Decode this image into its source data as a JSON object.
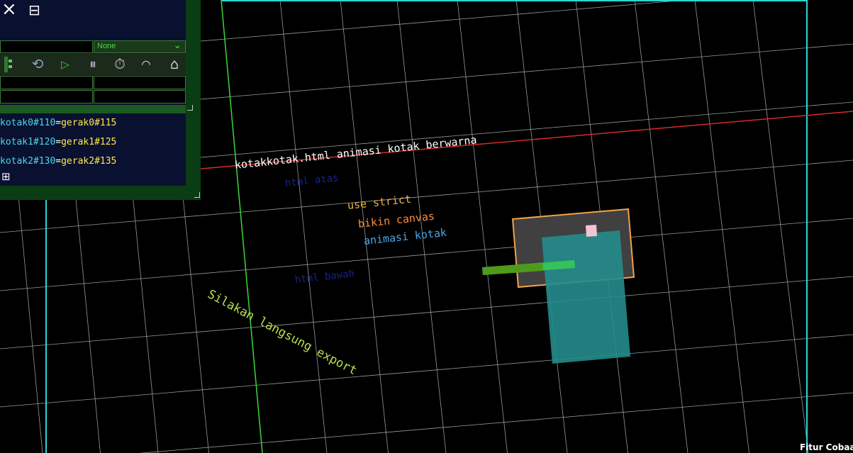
{
  "panel": {
    "close_icon": "×",
    "minimize_icon": "⊟",
    "select_value": "None",
    "add_icon": "⊞",
    "toolbar_icons": [
      "hierarchy-icon",
      "reset-icon",
      "play-icon",
      "pause-icon",
      "timer-icon",
      "speedometer-icon",
      "tag-icon"
    ],
    "mappings": [
      {
        "left": "kotak0#110",
        "eq": "=",
        "right": "gerak0#115"
      },
      {
        "left": "kotak1#120",
        "eq": "=",
        "right": "gerak1#125"
      },
      {
        "left": "kotak2#130",
        "eq": "=",
        "right": "gerak2#135"
      }
    ]
  },
  "canvas": {
    "title": "kotakkotak.html animasi kotak berwarna",
    "html_atas": "html atas",
    "use_strict": "use strict",
    "bikin_canvas": "bikin canvas",
    "animasi_kotak": "animasi kotak",
    "html_bawah": "html bawah",
    "silakan": "Silakan langsung export"
  },
  "footer": {
    "label": "Fitur Cobaan"
  },
  "colors": {
    "grid": "#a9b7b2",
    "cyan_border": "#2ad6d6",
    "green_line": "#39d839",
    "red_line": "#d62a2a",
    "white_text": "#ffffff",
    "dark_blue_text": "#15238c",
    "orange_text": "#f0b34a",
    "light_orange_text": "#ff8c3a",
    "light_blue_text": "#4aa6e8",
    "lime_text": "#b6e04a",
    "yellow": "#ffe94a",
    "box_border": "#f2a14a",
    "box_fill": "#404040",
    "teal_rect": "#238c8c"
  }
}
